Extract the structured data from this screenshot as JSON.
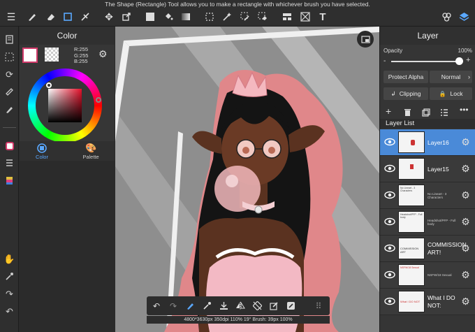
{
  "hint": "The Shape (Rectangle) Tool allows you to make a rectangle with whichever brush you have selected.",
  "top_tools": [
    "menu-icon",
    "brush-icon",
    "eraser-icon",
    "shape-rect-icon",
    "smudge-icon",
    "move-icon",
    "transform-icon",
    "fill-color-icon",
    "bucket-icon",
    "gradient-icon",
    "select-rect-icon",
    "magic-wand-icon",
    "select-pen-icon",
    "select-eraser-icon",
    "panel-icon",
    "text-icon",
    "material-icon",
    "layers-icon"
  ],
  "color_panel": {
    "title": "Color",
    "r": "R:255",
    "g": "G:255",
    "b": "B:255",
    "tab_color": "Color",
    "tab_palette": "Palette",
    "current_color": "#ffffff"
  },
  "layer_panel": {
    "title": "Layer",
    "opacity_label": "Opacity",
    "opacity_value": "100%",
    "opacity": 1.0,
    "protect_alpha": "Protect Alpha",
    "blend_mode": "Normal",
    "clipping": "Clipping",
    "lock": "Lock",
    "list_title": "Layer List",
    "layers": [
      {
        "name": "Layer16",
        "selected": true,
        "thumb_text": ""
      },
      {
        "name": "Layer15",
        "selected": false,
        "thumb_text": ""
      },
      {
        "name": "",
        "selected": false,
        "thumb_text": "No Lineart - 3 Characters"
      },
      {
        "name": "",
        "selected": false,
        "thumb_text": "Headshot/PFP - Full body"
      },
      {
        "name": "COMMISSION ART!",
        "selected": false,
        "thumb_text": "COMMISSION ART"
      },
      {
        "name": "",
        "selected": false,
        "thumb_text": "NSFW/18 Sexual"
      },
      {
        "name": "What I DO NOT:",
        "selected": false,
        "thumb_text": "What I DO NOT"
      }
    ]
  },
  "status": "4800*3630px 350dpi 110% 19° Brush: 39px 100%"
}
